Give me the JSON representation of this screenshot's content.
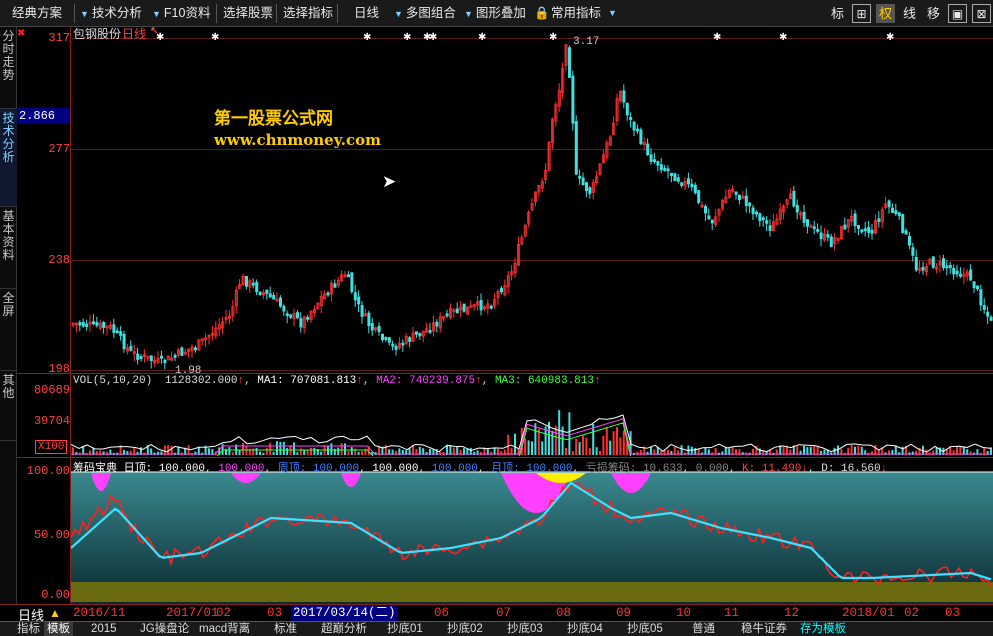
{
  "toolbar": {
    "scheme": "经典方案",
    "tech": "技术分析",
    "f10": "F10资料",
    "select_stock": "选择股票",
    "select_ind": "选择指标",
    "period": "日线",
    "multi": "多图组合",
    "overlay": "图形叠加",
    "common": "常用指标",
    "right_buttons": [
      "标",
      "⊞",
      "权",
      "线",
      "移",
      "▣",
      "⊠"
    ]
  },
  "sidebar": [
    "分时走势",
    "技术分析",
    "基本资料",
    "全屏",
    "其他"
  ],
  "main": {
    "stock_name": "包钢股份",
    "period_label": "日线",
    "price_label": "2.866",
    "y_ticks": [
      "317",
      "277",
      "238",
      "198"
    ],
    "high_label": "3.17",
    "low_label": "1.98",
    "watermark_cn": "第一股票公式网",
    "watermark_url": "www.chnmoney.com"
  },
  "vol": {
    "title": "VOL(5,10,20)",
    "vol": "1128302.000",
    "ma1": "MA1: 707081.813",
    "ma2": "MA2: 740239.875",
    "ma3": "MA3: 640983.813",
    "y_ticks": [
      "80689",
      "39704"
    ],
    "unit": "X100",
    "colors": {
      "ma1": "#ffffff",
      "ma2": "#ff40ff",
      "ma3": "#40ff40"
    }
  },
  "chip": {
    "title": "筹码宝典",
    "day_top": "日顶: 100.000",
    "v1": "100.000",
    "week_top": "周顶: 100.000",
    "v2": "100.000",
    "v3": "100.000",
    "month_top": "月顶: 100.000",
    "loss": "亏损筹码: 10.633",
    "v4": "0.000",
    "k": "K: 11.490",
    "d": "D: 16.560",
    "y_ticks": [
      "100.00",
      "50.00",
      "0.00"
    ]
  },
  "datebar": {
    "period": "日线",
    "dates": [
      "2016/11",
      "2017/01",
      "02",
      "03",
      "2017/03/14(二)",
      "06",
      "07",
      "08",
      "09",
      "10",
      "11",
      "12",
      "2018/01",
      "02",
      "03"
    ]
  },
  "statusbar": [
    "指标",
    "模板",
    "2015",
    "JG操盘论",
    "macd背离",
    "标准",
    "超巅分析",
    "抄底01",
    "抄底02",
    "抄底03",
    "抄底04",
    "抄底05",
    "普通",
    "稳牛证券",
    "存为模板"
  ]
}
